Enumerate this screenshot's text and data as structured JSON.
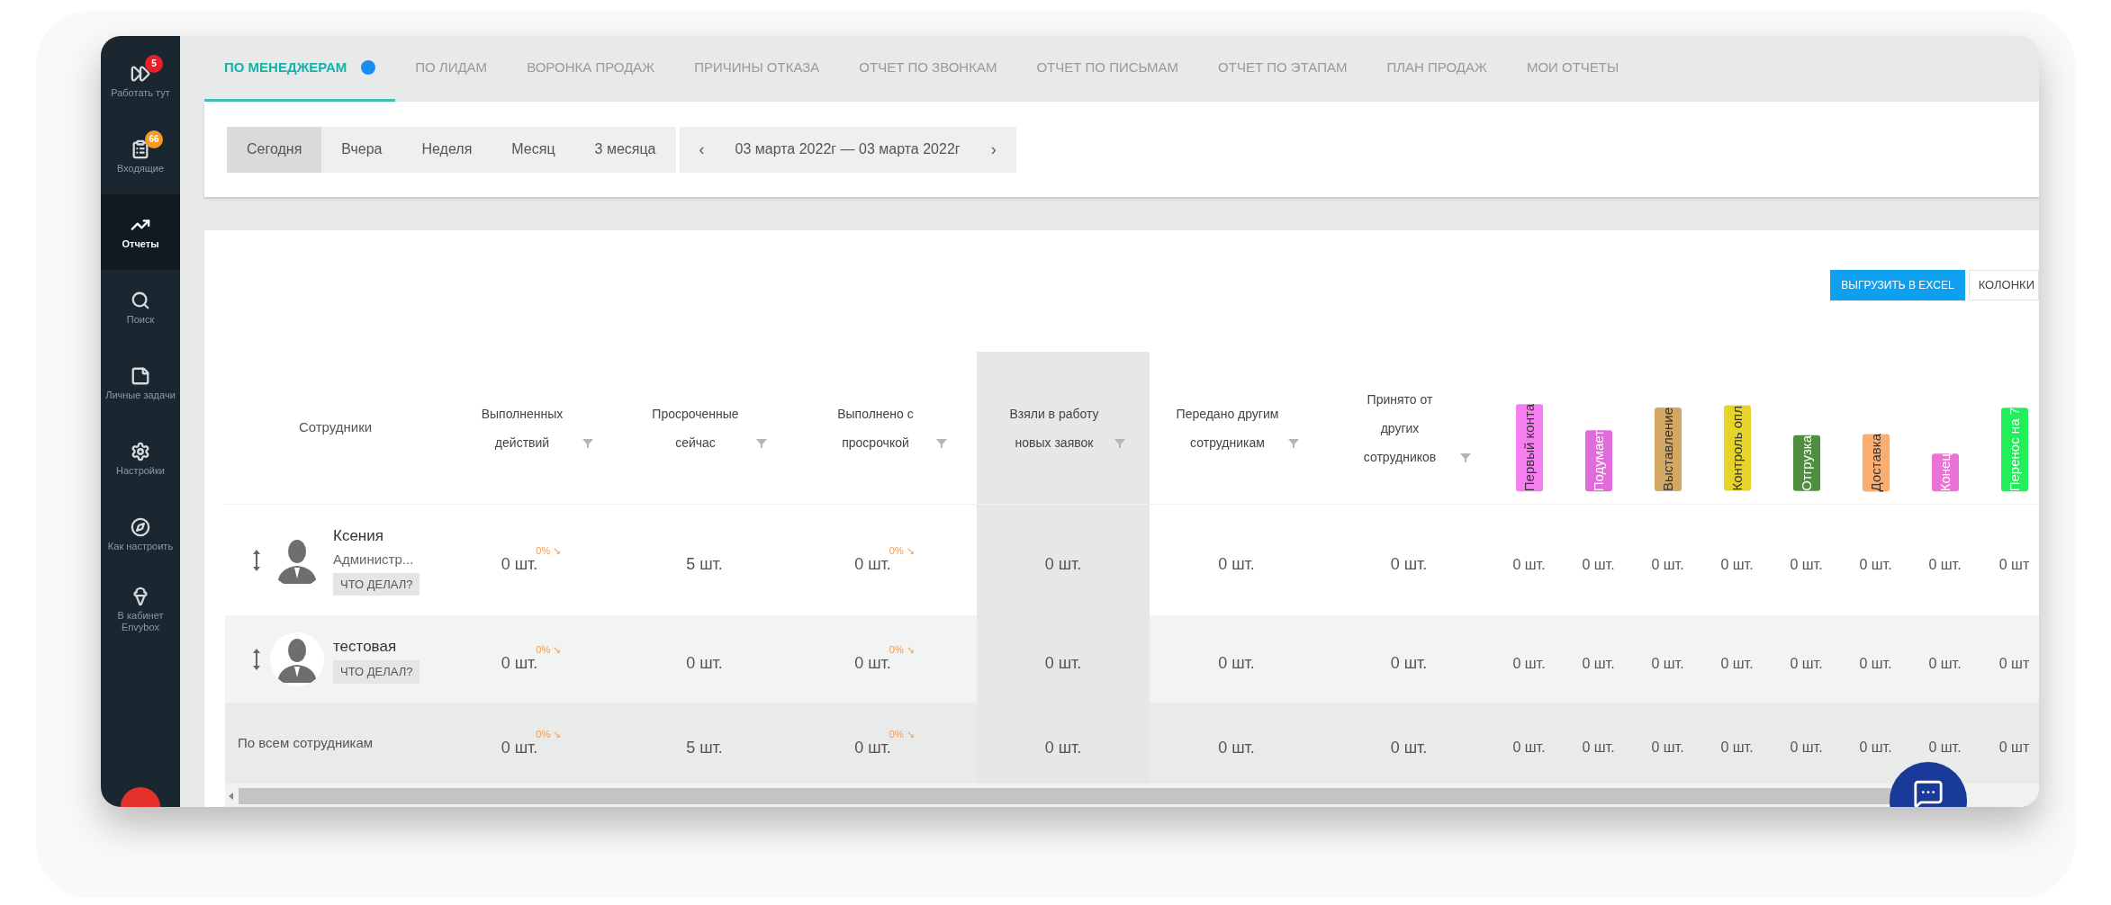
{
  "sidebar": {
    "items": [
      {
        "label": "Работать тут",
        "selected": false,
        "badge": {
          "text": "5",
          "color": "#e8202a"
        }
      },
      {
        "label": "Входящие",
        "selected": false,
        "badge": {
          "text": "66",
          "color": "#f59a23"
        }
      },
      {
        "label": "Отчеты",
        "selected": true
      },
      {
        "label": "Поиск",
        "selected": false
      },
      {
        "label": "Личные задачи",
        "selected": false
      },
      {
        "label": "Настройки",
        "selected": false
      },
      {
        "label": "Как настроить",
        "selected": false
      },
      {
        "label": "В кабинет Envybox",
        "selected": false
      }
    ]
  },
  "tabs": [
    {
      "label": "ПО МЕНЕДЖЕРАМ",
      "selected": true,
      "dot": true
    },
    {
      "label": "ПО ЛИДАМ",
      "selected": false,
      "dot": false
    },
    {
      "label": "ВОРОНКА ПРОДАЖ",
      "selected": false,
      "dot": false
    },
    {
      "label": "ПРИЧИНЫ ОТКАЗА",
      "selected": false,
      "dot": false
    },
    {
      "label": "ОТЧЕТ ПО ЗВОНКАМ",
      "selected": false,
      "dot": false
    },
    {
      "label": "ОТЧЕТ ПО ПИСЬМАМ",
      "selected": false,
      "dot": false
    },
    {
      "label": "ОТЧЕТ ПО ЭТАПАМ",
      "selected": false,
      "dot": false
    },
    {
      "label": "ПЛАН ПРОДАЖ",
      "selected": false,
      "dot": false
    },
    {
      "label": "МОИ ОТЧЕТЫ",
      "selected": false,
      "dot": false
    }
  ],
  "periods": [
    {
      "label": "Сегодня",
      "selected": true
    },
    {
      "label": "Вчера",
      "selected": false
    },
    {
      "label": "Неделя",
      "selected": false
    },
    {
      "label": "Месяц",
      "selected": false
    },
    {
      "label": "3 месяца",
      "selected": false
    }
  ],
  "date_range": {
    "prev": "‹",
    "label": "03 марта 2022г — 03 марта 2022г",
    "next": "›"
  },
  "table": {
    "export_button": "ВЫГРУЗИТЬ В EXCEL",
    "columns_button": "КОЛОНКИ",
    "employee_header": "Сотрудники",
    "columns": [
      {
        "kind": "metric",
        "label": "Выполненных действий",
        "highlighted": false
      },
      {
        "kind": "metric",
        "label": "Просроченные сейчас",
        "highlighted": false
      },
      {
        "kind": "metric",
        "label": "Выполнено с просрочкой",
        "highlighted": false
      },
      {
        "kind": "metric",
        "label": "Взяли в работу новых заявок",
        "highlighted": true
      },
      {
        "kind": "metric",
        "label": "Передано другим сотрудникам",
        "highlighted": false
      },
      {
        "kind": "metric",
        "label": "Принято от других сотрудников",
        "highlighted": false
      },
      {
        "kind": "stage",
        "label": "Первый конта",
        "color": "#f77ef0"
      },
      {
        "kind": "stage",
        "label": "Подумает",
        "color": "#e06bdb"
      },
      {
        "kind": "stage",
        "label": "Выставление",
        "color": "#d4a862"
      },
      {
        "kind": "stage",
        "label": "Контроль опл",
        "color": "#e6d42a"
      },
      {
        "kind": "stage",
        "label": "Отгрузка",
        "color": "#4e8f3f"
      },
      {
        "kind": "stage",
        "label": "Доставка",
        "color": "#fbae72"
      },
      {
        "kind": "stage",
        "label": "Конец",
        "color": "#ea73d8"
      },
      {
        "kind": "stage",
        "label": "Перенос на 7",
        "color": "#22ee5a"
      }
    ],
    "rows": [
      {
        "name": "Ксения",
        "role": "Администр...",
        "action": "ЧТО ДЕЛАЛ?",
        "cells": [
          {
            "value": "0 шт.",
            "delta": "0% ↘"
          },
          {
            "value": "5 шт."
          },
          {
            "value": "0 шт.",
            "delta": "0% ↘"
          },
          {
            "value": "0 шт."
          },
          {
            "value": "0 шт."
          },
          {
            "value": "0 шт."
          },
          {
            "value": "0 шт."
          },
          {
            "value": "0 шт."
          },
          {
            "value": "0 шт."
          },
          {
            "value": "0 шт."
          },
          {
            "value": "0 шт."
          },
          {
            "value": "0 шт."
          },
          {
            "value": "0 шт."
          },
          {
            "value": "0 шт"
          }
        ]
      },
      {
        "name": "тестовая",
        "action": "ЧТО ДЕЛАЛ?",
        "cells": [
          {
            "value": "0 шт.",
            "delta": "0% ↘"
          },
          {
            "value": "0 шт."
          },
          {
            "value": "0 шт.",
            "delta": "0% ↘"
          },
          {
            "value": "0 шт."
          },
          {
            "value": "0 шт."
          },
          {
            "value": "0 шт."
          },
          {
            "value": "0 шт."
          },
          {
            "value": "0 шт."
          },
          {
            "value": "0 шт."
          },
          {
            "value": "0 шт."
          },
          {
            "value": "0 шт."
          },
          {
            "value": "0 шт."
          },
          {
            "value": "0 шт."
          },
          {
            "value": "0 шт"
          }
        ]
      }
    ],
    "total": {
      "label": "По всем сотрудникам",
      "cells": [
        {
          "value": "0 шт.",
          "delta": "0% ↘"
        },
        {
          "value": "5 шт."
        },
        {
          "value": "0 шт.",
          "delta": "0% ↘"
        },
        {
          "value": "0 шт."
        },
        {
          "value": "0 шт."
        },
        {
          "value": "0 шт."
        },
        {
          "value": "0 шт."
        },
        {
          "value": "0 шт."
        },
        {
          "value": "0 шт."
        },
        {
          "value": "0 шт."
        },
        {
          "value": "0 шт."
        },
        {
          "value": "0 шт."
        },
        {
          "value": "0 шт."
        },
        {
          "value": "0 шт"
        }
      ]
    }
  }
}
